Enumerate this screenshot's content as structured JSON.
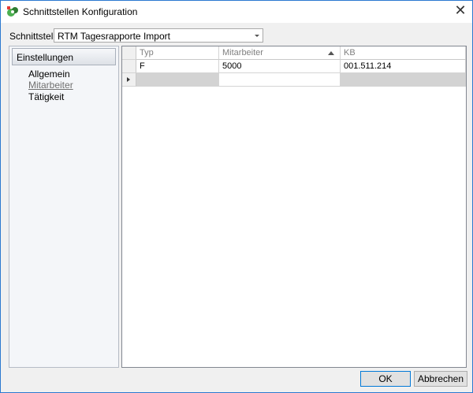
{
  "window": {
    "title": "Schnittstellen Konfiguration",
    "close_glyph": "✕"
  },
  "interface": {
    "label": "Schnittstelle",
    "selected": "RTM Tagesrapporte Import"
  },
  "sidebar": {
    "header": "Einstellungen",
    "items": [
      {
        "label": "Allgemein",
        "active": false
      },
      {
        "label": "Mitarbeiter",
        "active": true
      },
      {
        "label": "Tätigkeit",
        "active": false
      }
    ]
  },
  "grid": {
    "columns": [
      {
        "label": "Typ"
      },
      {
        "label": "Mitarbeiter",
        "sorted": "ascending"
      },
      {
        "label": "KB"
      }
    ],
    "rows": [
      {
        "typ": "F",
        "mitarbeiter": "5000",
        "kb": "001.511.214"
      }
    ]
  },
  "buttons": {
    "ok": "OK",
    "cancel": "Abbrechen"
  },
  "colors": {
    "accent_border": "#2b79d0",
    "dialog_bg": "#f0f0f0",
    "new_row_cell": "#d3d3d3"
  }
}
